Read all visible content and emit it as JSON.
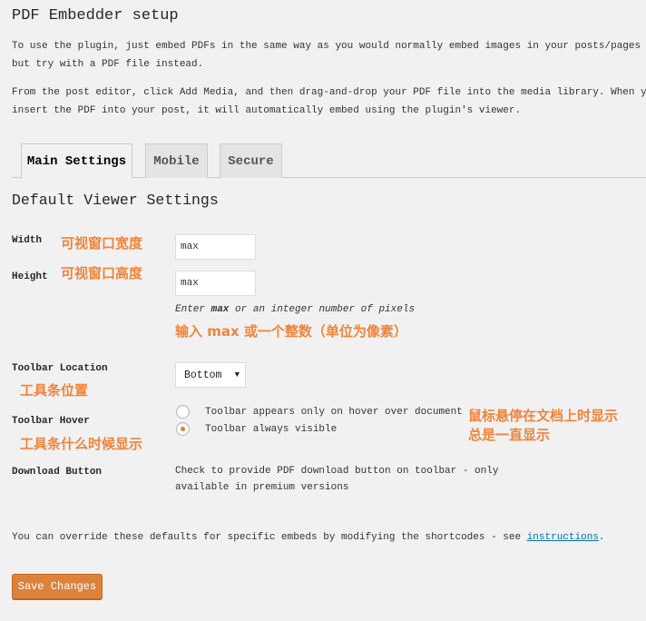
{
  "page": {
    "title": "PDF Embedder setup",
    "intro1_line1": "To use the plugin, just embed PDFs in the same way as you would normally embed images in your posts/pages -",
    "intro1_line2": "but try with a PDF file instead.",
    "intro2_line1": "From the post editor, click Add Media, and then drag-and-drop your PDF file into the media library. When you",
    "intro2_line2": "insert the PDF into your post, it will automatically embed using the plugin's viewer."
  },
  "tabs": [
    {
      "label": "Main Settings",
      "active": true
    },
    {
      "label": "Mobile"
    },
    {
      "label": "Secure"
    }
  ],
  "section_title": "Default Viewer Settings",
  "fields": {
    "width": {
      "label": "Width",
      "annotation": "可视窗口宽度",
      "value": "max"
    },
    "height": {
      "label": "Height",
      "annotation": "可视窗口高度",
      "value": "max"
    },
    "hint_pre": "Enter ",
    "hint_bold": "max",
    "hint_post": " or an integer number of pixels",
    "hint_annotation": "输入 max 或一个整数（单位为像素）",
    "toolbar_location": {
      "label": "Toolbar Location",
      "annotation": "工具条位置",
      "value": "Bottom"
    },
    "toolbar_hover": {
      "label": "Toolbar Hover",
      "annotation": "工具条什么时候显示",
      "options": [
        {
          "label": "Toolbar appears only on hover over document",
          "selected": false
        },
        {
          "label": "Toolbar always visible",
          "selected": true
        }
      ],
      "annotation_options": [
        "鼠标悬停在文档上时显示",
        "总是一直显示"
      ]
    },
    "download": {
      "label": "Download Button",
      "desc_line1": "Check to provide PDF download button on toolbar - only",
      "desc_line2": "available in premium versions"
    }
  },
  "footer": {
    "text": "You can override these defaults for specific embeds by modifying the shortcodes - see ",
    "link": "instructions",
    "end": "."
  },
  "save_label": "Save Changes",
  "colors": {
    "accent": "#dd823b",
    "annotation": "#f0843c",
    "link": "#0073aa"
  }
}
